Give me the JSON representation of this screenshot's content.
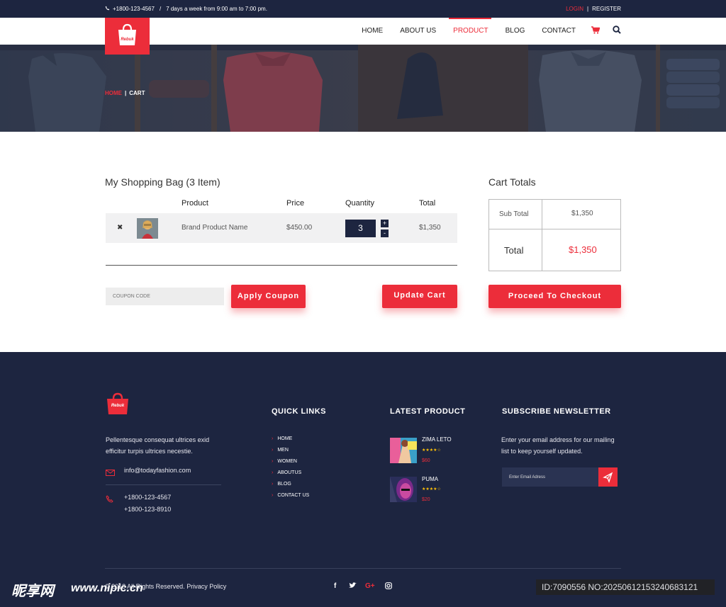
{
  "topbar": {
    "phone": "+1800-123-4567",
    "separator": "/",
    "hours": "7 days a week from 9:00 am to 7:00 pm.",
    "login": "LOGIN",
    "divider": "|",
    "register": "REGISTER"
  },
  "logo": {
    "text": "Rebuk"
  },
  "nav": {
    "items": [
      "HOME",
      "ABOUT US",
      "PRODUCT",
      "BLOG",
      "CONTACT"
    ],
    "active": "PRODUCT",
    "cart_icon": "cart-icon",
    "search_icon": "search-icon"
  },
  "breadcrumb": {
    "home": "HOME",
    "separator": "|",
    "current": "CART"
  },
  "bag": {
    "title": "My Shopping Bag (3 Item)",
    "columns": [
      "Product",
      "Price",
      "Quantity",
      "Total"
    ],
    "rows": [
      {
        "remove": "✖",
        "name": "Brand Product Name",
        "price": "$450.00",
        "quantity": "3",
        "total": "$1,350"
      }
    ],
    "plus": "+",
    "minus": "-",
    "coupon_placeholder": "COUPON CODE",
    "apply_label": "Apply Coupon",
    "update_label": "Update Cart"
  },
  "totals": {
    "title": "Cart Totals",
    "subtotal_label": "Sub Total",
    "subtotal_value": "$1,350",
    "total_label": "Total",
    "total_value": "$1,350",
    "checkout_label": "Proceed To Checkout"
  },
  "footer": {
    "logo_text": "Rebuk",
    "about": "Pellentesque consequat ultrices exid efficitur turpis ultrices necestie.",
    "email": "info@todayfashion.com",
    "phone1": "+1800-123-4567",
    "phone2": "+1800-123-8910",
    "quick_links_title": "QUICK LINKS",
    "quick_links": [
      "HOME",
      "MEN",
      "WOMEN",
      "ABOUTUS",
      "BLOG",
      "CONTACT US"
    ],
    "latest_title": "LATEST PRODUCT",
    "products": [
      {
        "name": "ZIMA LETO",
        "stars": "★★★★☆",
        "price": "$60"
      },
      {
        "name": "PUMA",
        "stars": "★★★★☆",
        "price": "$20"
      }
    ],
    "newsletter_title": "SUBSCRIBE NEWSLETTER",
    "newsletter_text": "Enter your email address for our mailing list to keep yourself updated.",
    "email_placeholder": "Enter Email Adress",
    "copyright": "© 2018 All Rights Reserved. Privacy Policy",
    "social": [
      "f",
      "t",
      "G+",
      "ig"
    ]
  },
  "watermark": {
    "site_cn": "昵享网",
    "site_url": "www.nipic.cn",
    "id_text": "ID:7090556 NO:20250612153240683121"
  },
  "colors": {
    "accent": "#ec2d3a",
    "navy": "#1d2540"
  }
}
